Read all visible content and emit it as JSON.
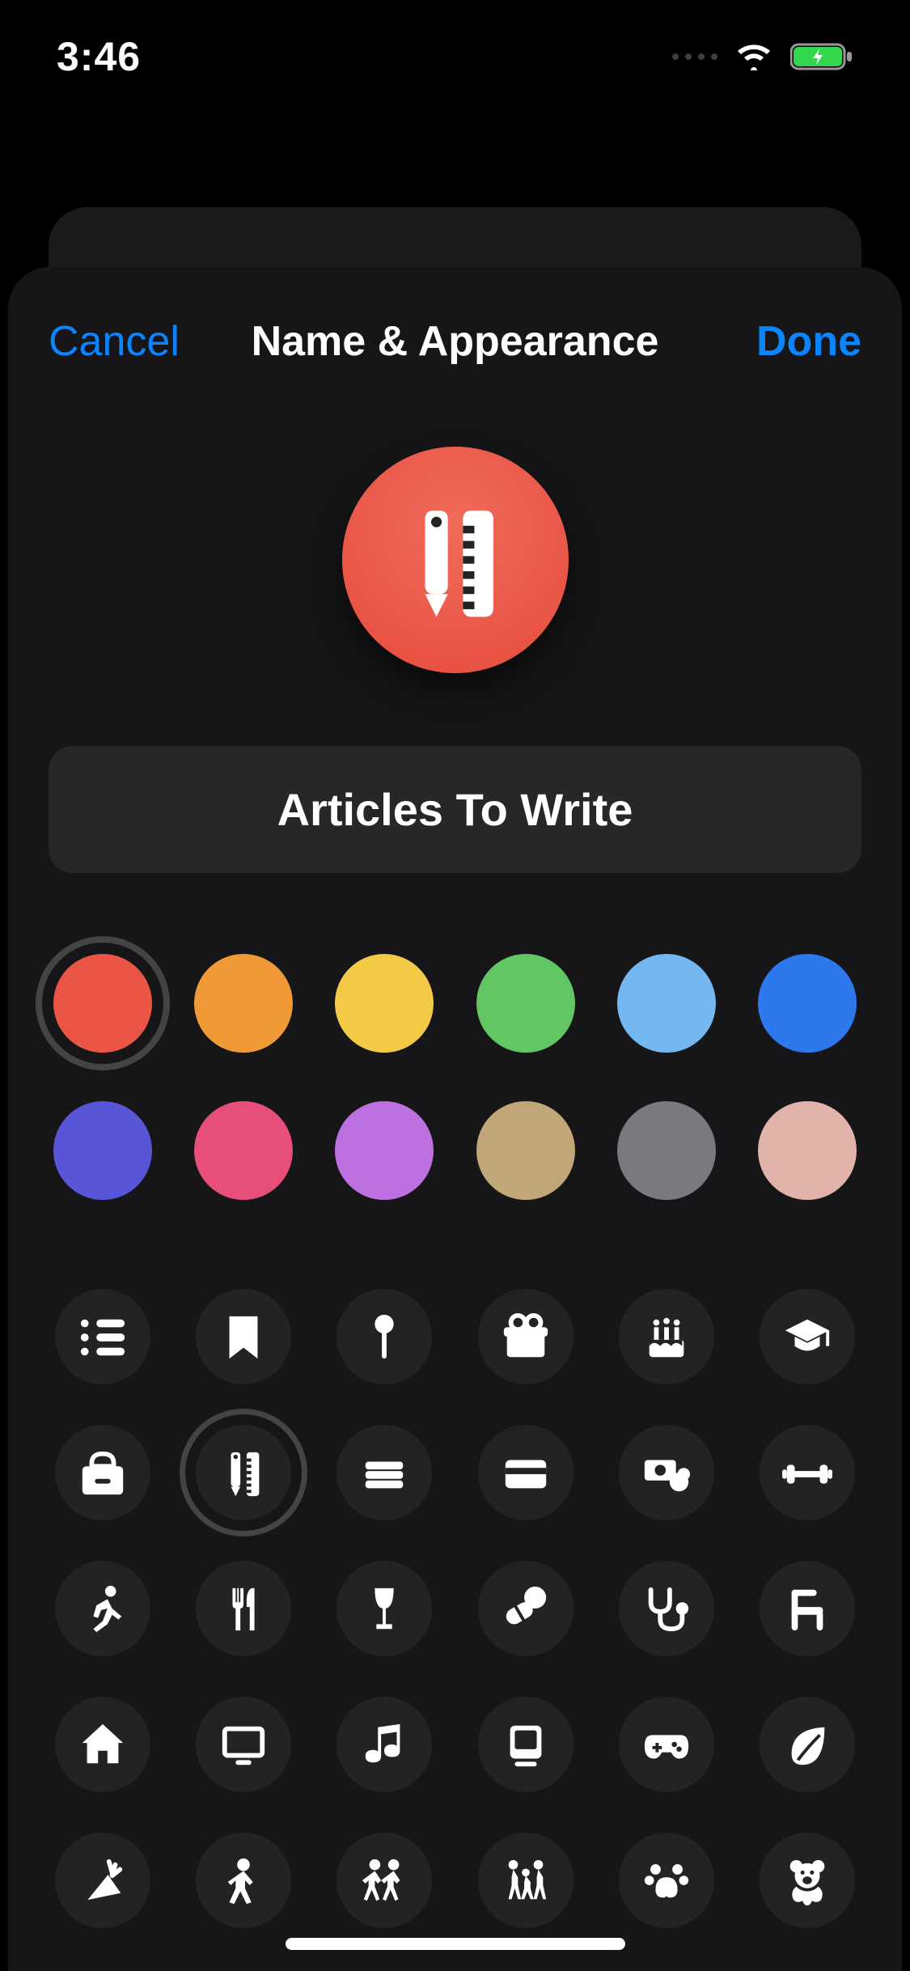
{
  "status": {
    "time": "3:46"
  },
  "header": {
    "title": "Name & Appearance",
    "cancel": "Cancel",
    "done": "Done"
  },
  "list": {
    "name": "Articles To Write"
  },
  "preview": {
    "color": "#eb5545",
    "gradient_top": "#f06b5a",
    "gradient_bottom": "#e64b3c",
    "icon": "pencil-ruler"
  },
  "colors": [
    {
      "name": "red",
      "hex": "#eb5545",
      "selected": true
    },
    {
      "name": "orange",
      "hex": "#f09a37",
      "selected": false
    },
    {
      "name": "yellow",
      "hex": "#f2ca45",
      "selected": false
    },
    {
      "name": "green",
      "hex": "#62c664",
      "selected": false
    },
    {
      "name": "lightblue",
      "hex": "#74b8f2",
      "selected": false
    },
    {
      "name": "blue",
      "hex": "#2e78ee",
      "selected": false
    },
    {
      "name": "indigo",
      "hex": "#5855d6",
      "selected": false
    },
    {
      "name": "pink",
      "hex": "#e74f7a",
      "selected": false
    },
    {
      "name": "purple",
      "hex": "#bd71e1",
      "selected": false
    },
    {
      "name": "tan",
      "hex": "#c1a678",
      "selected": false
    },
    {
      "name": "gray",
      "hex": "#79797e",
      "selected": false
    },
    {
      "name": "blush",
      "hex": "#e1b3ab",
      "selected": false
    }
  ],
  "icons": [
    {
      "name": "list",
      "selected": false
    },
    {
      "name": "bookmark",
      "selected": false
    },
    {
      "name": "pin",
      "selected": false
    },
    {
      "name": "gift",
      "selected": false
    },
    {
      "name": "cake",
      "selected": false
    },
    {
      "name": "graduation",
      "selected": false
    },
    {
      "name": "backpack",
      "selected": false
    },
    {
      "name": "pencil-ruler",
      "selected": true
    },
    {
      "name": "wallet",
      "selected": false
    },
    {
      "name": "credit-card",
      "selected": false
    },
    {
      "name": "money",
      "selected": false
    },
    {
      "name": "dumbbell",
      "selected": false
    },
    {
      "name": "running",
      "selected": false
    },
    {
      "name": "utensils",
      "selected": false
    },
    {
      "name": "wine-glass",
      "selected": false
    },
    {
      "name": "pills",
      "selected": false
    },
    {
      "name": "stethoscope",
      "selected": false
    },
    {
      "name": "chair",
      "selected": false
    },
    {
      "name": "house",
      "selected": false
    },
    {
      "name": "tv",
      "selected": false
    },
    {
      "name": "music-note",
      "selected": false
    },
    {
      "name": "computer",
      "selected": false
    },
    {
      "name": "game-controller",
      "selected": false
    },
    {
      "name": "leaf",
      "selected": false
    },
    {
      "name": "carrot",
      "selected": false
    },
    {
      "name": "person",
      "selected": false
    },
    {
      "name": "people-pair",
      "selected": false
    },
    {
      "name": "family",
      "selected": false
    },
    {
      "name": "paw",
      "selected": false
    },
    {
      "name": "teddy-bear",
      "selected": false
    }
  ]
}
